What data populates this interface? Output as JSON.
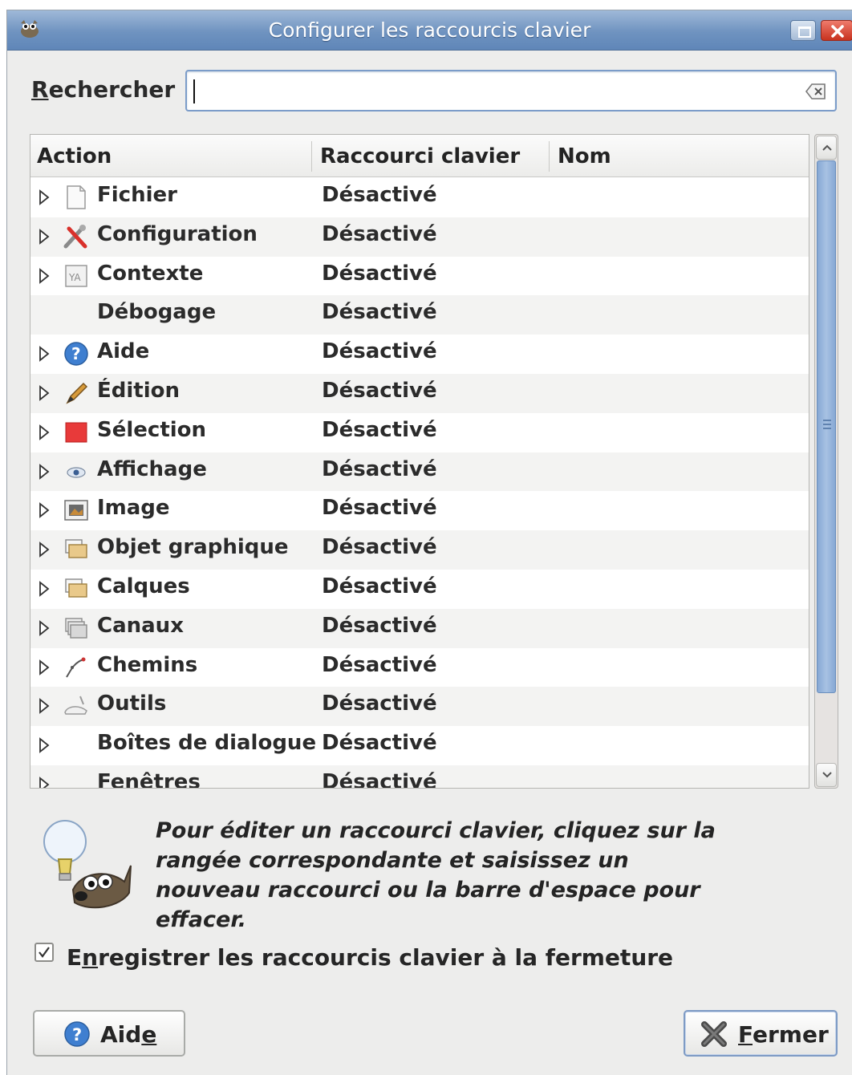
{
  "window": {
    "title": "Configurer les raccourcis clavier"
  },
  "search": {
    "label_first": "R",
    "label_rest": "echercher :",
    "value": ""
  },
  "table": {
    "columns": [
      "Action",
      "Raccourci clavier",
      "Nom"
    ],
    "rows": [
      {
        "action": "Fichier",
        "shortcut": "Désactivé",
        "icon": "document-icon",
        "expandable": true
      },
      {
        "action": "Configuration",
        "shortcut": "Désactivé",
        "icon": "tools-icon",
        "expandable": true
      },
      {
        "action": "Contexte",
        "shortcut": "Désactivé",
        "icon": "context-icon",
        "expandable": true
      },
      {
        "action": "Débogage",
        "shortcut": "Désactivé",
        "icon": "none",
        "expandable": false
      },
      {
        "action": "Aide",
        "shortcut": "Désactivé",
        "icon": "help-icon",
        "expandable": true
      },
      {
        "action": "Édition",
        "shortcut": "Désactivé",
        "icon": "pencil-icon",
        "expandable": true
      },
      {
        "action": "Sélection",
        "shortcut": "Désactivé",
        "icon": "selection-icon",
        "expandable": true
      },
      {
        "action": "Affichage",
        "shortcut": "Désactivé",
        "icon": "eye-icon",
        "expandable": true
      },
      {
        "action": "Image",
        "shortcut": "Désactivé",
        "icon": "image-icon",
        "expandable": true
      },
      {
        "action": "Objet graphique",
        "shortcut": "Désactivé",
        "icon": "drawable-icon",
        "expandable": true
      },
      {
        "action": "Calques",
        "shortcut": "Désactivé",
        "icon": "layers-icon",
        "expandable": true
      },
      {
        "action": "Canaux",
        "shortcut": "Désactivé",
        "icon": "channels-icon",
        "expandable": true
      },
      {
        "action": "Chemins",
        "shortcut": "Désactivé",
        "icon": "paths-icon",
        "expandable": true
      },
      {
        "action": "Outils",
        "shortcut": "Désactivé",
        "icon": "tools-box-icon",
        "expandable": true
      },
      {
        "action": "Boîtes de dialogue",
        "shortcut": "Désactivé",
        "icon": "none",
        "expandable": true
      },
      {
        "action": "Fenêtres",
        "shortcut": "Désactivé",
        "icon": "none",
        "expandable": true
      }
    ]
  },
  "hint": {
    "text": "Pour éditer un raccourci clavier, cliquez sur la rangée correspondante et saisissez un nouveau raccourci ou la barre d'espace pour effacer."
  },
  "save_option": {
    "checked": true,
    "label_first": "E",
    "label_mid": "n",
    "label_rest": "registrer les raccourcis clavier à la fermeture"
  },
  "buttons": {
    "help_pre": "Aid",
    "help_ul": "e",
    "close_ul": "F",
    "close_rest": "ermer"
  },
  "colors": {
    "titlebar": "#6f93c0",
    "scroll_thumb": "#86a8d4",
    "row_alt": "#f3f3f2"
  }
}
